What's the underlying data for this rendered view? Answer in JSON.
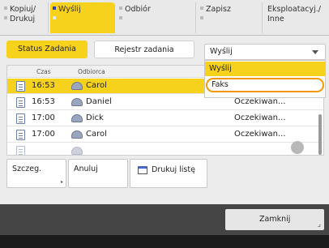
{
  "top_tabs": [
    {
      "label": "Kopiuj/\nDrukuj",
      "active": false
    },
    {
      "label": "Wyślij",
      "active": true
    },
    {
      "label": "Odbiór",
      "active": false
    },
    {
      "label": "Zapisz",
      "active": false
    },
    {
      "label": "Eksploatacyj./\nInne",
      "active": false
    }
  ],
  "sub_tabs": {
    "status": "Status Zadania",
    "log": "Rejestr zadania"
  },
  "dropdown": {
    "value": "Wyślij",
    "options": [
      "Wyślij",
      "Faks"
    ]
  },
  "table": {
    "headers": {
      "time": "Czas",
      "recipient": "Odbiorca"
    },
    "rows": [
      {
        "time": "16:53",
        "name": "Carol",
        "status": ""
      },
      {
        "time": "16:53",
        "name": "Daniel",
        "status": "Oczekiwan..."
      },
      {
        "time": "17:00",
        "name": "Dick",
        "status": "Oczekiwan..."
      },
      {
        "time": "17:00",
        "name": "Carol",
        "status": "Oczekiwan..."
      }
    ]
  },
  "buttons": {
    "details": "Szczeg.",
    "cancel": "Anuluj",
    "print_list": "Drukuj listę"
  },
  "close_label": "Zamknij",
  "colors": {
    "accent": "#f6d21c",
    "focus": "#f39800",
    "bottom_bar": "#454545"
  },
  "icons": {
    "row_doc": "document-icon",
    "recipient": "recipient-icon",
    "print": "print-icon"
  }
}
